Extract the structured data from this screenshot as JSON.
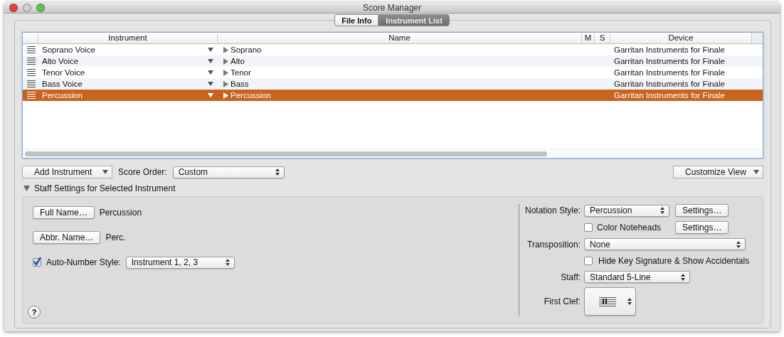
{
  "window": {
    "title": "Score Manager"
  },
  "tabs": [
    {
      "label": "File Info",
      "selected": false
    },
    {
      "label": "Instrument List",
      "selected": true
    }
  ],
  "table": {
    "columns": [
      "Instrument",
      "Name",
      "M",
      "S",
      "Device"
    ],
    "rows": [
      {
        "instrument": "Soprano Voice",
        "name": "Soprano",
        "device": "Garritan Instruments for Finale",
        "selected": false
      },
      {
        "instrument": "Alto Voice",
        "name": "Alto",
        "device": "Garritan Instruments for Finale",
        "selected": false
      },
      {
        "instrument": "Tenor Voice",
        "name": "Tenor",
        "device": "Garritan Instruments for Finale",
        "selected": false
      },
      {
        "instrument": "Bass Voice",
        "name": "Bass",
        "device": "Garritan Instruments for Finale",
        "selected": false
      },
      {
        "instrument": "Percussion",
        "name": "Percussion",
        "device": "Garritan Instruments for Finale",
        "selected": true
      }
    ]
  },
  "toolbar": {
    "add_button": "Add Instrument",
    "score_order_label": "Score Order:",
    "score_order": "Custom",
    "customize_button": "Customize View"
  },
  "staff_settings": {
    "title": "Staff Settings for Selected Instrument",
    "expanded": true,
    "full_name_button": "Full Name…",
    "full_name": "Percussion",
    "abbr_name_button": "Abbr. Name…",
    "abbr_name": "Perc.",
    "auto_number": {
      "label": "Auto-Number Style:",
      "checked": true,
      "value": "Instrument 1, 2, 3"
    },
    "notation_style": {
      "label": "Notation Style:",
      "value": "Percussion",
      "button": "Settings…"
    },
    "color_noteheads": {
      "label": "Color Noteheads",
      "checked": false,
      "button": "Settings…"
    },
    "transposition": {
      "label": "Transposition:",
      "value": "None"
    },
    "hide_key": {
      "label": "Hide Key Signature & Show Accidentals",
      "checked": false
    },
    "staff": {
      "label": "Staff:",
      "value": "Standard 5-Line"
    },
    "first_clef": {
      "label": "First Clef:"
    },
    "help_button": "?"
  }
}
